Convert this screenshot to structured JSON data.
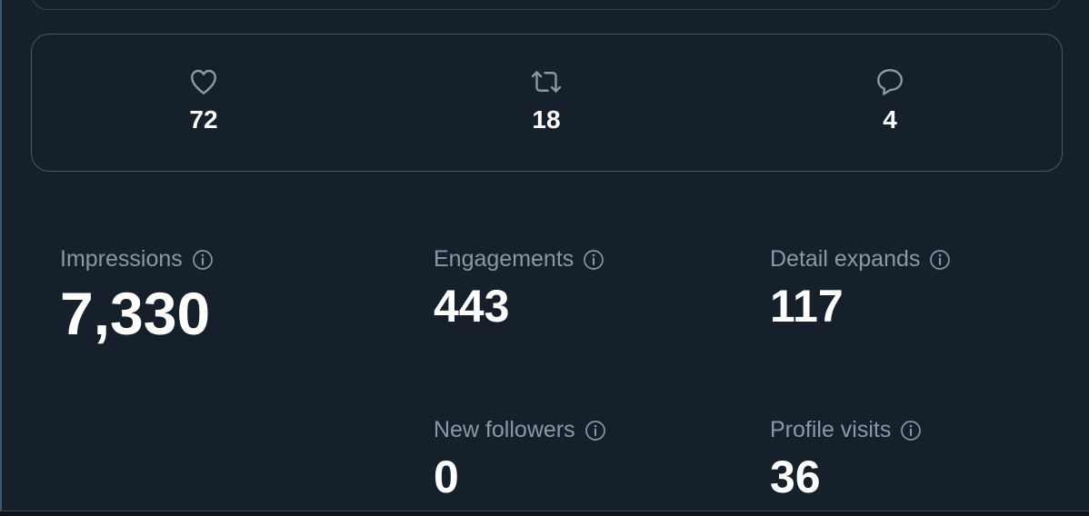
{
  "engagement": {
    "likes": {
      "icon": "heart-icon",
      "count": "72"
    },
    "retweets": {
      "icon": "retweet-icon",
      "count": "18"
    },
    "replies": {
      "icon": "reply-icon",
      "count": "4"
    }
  },
  "metrics": {
    "impressions": {
      "label": "Impressions",
      "value": "7,330"
    },
    "engagements": {
      "label": "Engagements",
      "value": "443"
    },
    "detail_expands": {
      "label": "Detail expands",
      "value": "117"
    },
    "new_followers": {
      "label": "New followers",
      "value": "0"
    },
    "profile_visits": {
      "label": "Profile visits",
      "value": "36"
    }
  },
  "colors": {
    "background": "#15202b",
    "border": "#38444d",
    "secondary_text": "#8b98a5",
    "primary_text": "#ffffff"
  }
}
